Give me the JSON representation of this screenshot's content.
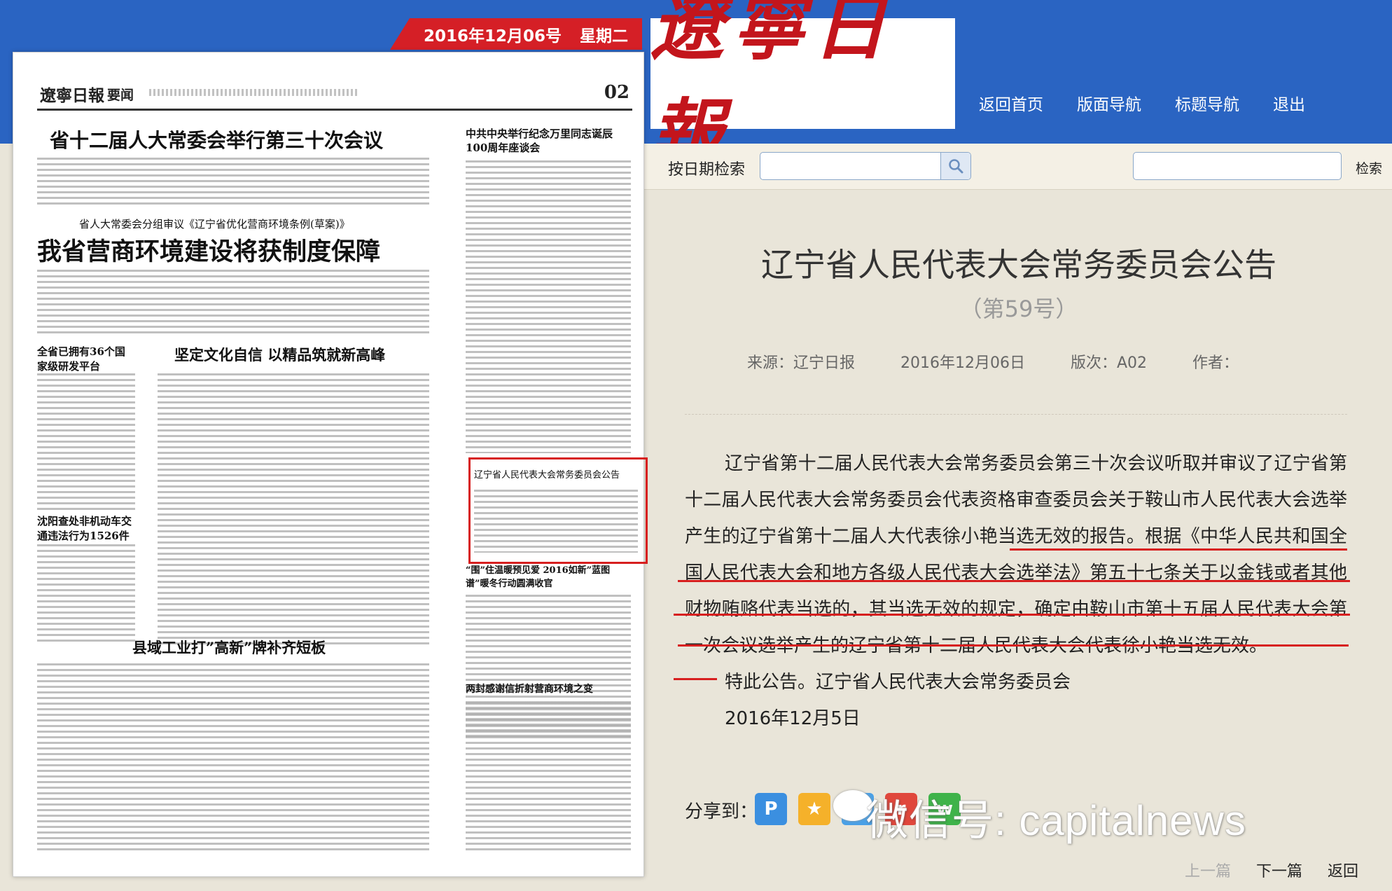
{
  "header": {
    "date": "2016年12月06号",
    "weekday": "星期二",
    "logo": "遼寧日報",
    "nav": [
      "返回首页",
      "版面导航",
      "标题导航",
      "退出"
    ]
  },
  "search": {
    "date_label": "按日期检索",
    "keyword_button": "检索"
  },
  "newspaper": {
    "masthead_logo": "遼寧日報",
    "section": "要闻",
    "page_number": "02",
    "headlines": {
      "h1": "省十二届人大常委会举行第三十次会议",
      "h2_kicker": "省人大常委会分组审议《辽宁省优化营商环境条例(草案)》",
      "h2": "我省营商环境建设将获制度保障",
      "h3": "坚定文化自信 以精品筑就新高峰",
      "side1": "中共中央举行纪念万里同志诞辰100周年座谈会",
      "left1": "全省已拥有36个国家级研发平台",
      "left2": "沈阳查处非机动车交通违法行为1526件",
      "announce": "辽宁省人民代表大会常务委员会公告",
      "side2": "“围”住温暖预见爱 2016如新”蓝图谱”暖冬行动圆满收官",
      "h4": "县域工业打”高新”牌补齐短板",
      "side3": "两封感谢信折射营商环境之变"
    }
  },
  "article": {
    "title": "辽宁省人民代表大会常务委员会公告",
    "subtitle": "（第59号）",
    "meta": {
      "source": "来源：辽宁日报",
      "date": "2016年12月06日",
      "edition": "版次：A02",
      "author": "作者："
    },
    "paragraphs": [
      "辽宁省第十二届人民代表大会常务委员会第三十次会议听取并审议了辽宁省第十二届人民代表大会常务委员会代表资格审查委员会关于鞍山市人民代表大会选举产生的辽宁省第十二届人大代表徐小艳当选无效的报告。根据《中华人民共和国全国人民代表大会和地方各级人民代表大会选举法》第五十七条关于以金钱或者其他财物贿赂代表当选的，其当选无效的规定，确定由鞍山市第十五届人民代表大会第一次会议选举产生的辽宁省第十二届人民代表大会代表徐小艳当选无效。",
      "特此公告。辽宁省人民代表大会常务委员会",
      "2016年12月5日"
    ],
    "share_label": "分享到：",
    "watermark": "微信号: capitalnews",
    "pager": {
      "prev": "上一篇",
      "next": "下一篇",
      "back": "返回"
    }
  },
  "colors": {
    "header_blue": "#2a64c2",
    "badge_red": "#d51f26",
    "underline_red": "#d71f1f"
  }
}
